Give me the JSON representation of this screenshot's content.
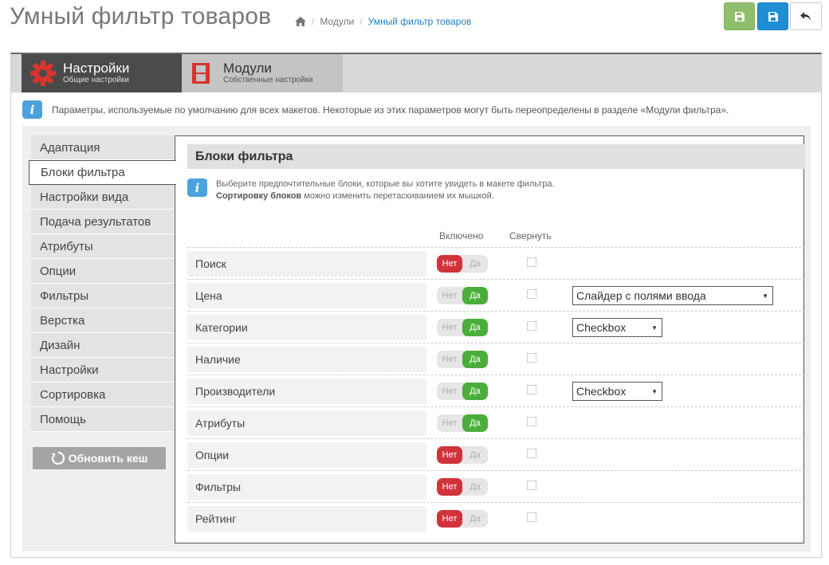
{
  "header": {
    "title": "Умный фильтр товаров",
    "breadcrumb": [
      "Модули",
      "Умный фильтр товаров"
    ]
  },
  "tabs": [
    {
      "title": "Настройки",
      "subtitle": "Общие настройки",
      "active": true
    },
    {
      "title": "Модули",
      "subtitle": "Собственные настройки",
      "active": false
    }
  ],
  "notice": "Параметры, используемые по умолчанию для всех макетов. Некоторые из этих параметров могут быть переопределены в разделе «Модули фильтра».",
  "sidebar": {
    "items": [
      {
        "label": "Адаптация"
      },
      {
        "label": "Блоки фильтра"
      },
      {
        "label": "Настройки вида"
      },
      {
        "label": "Подача результатов"
      },
      {
        "label": "Атрибуты"
      },
      {
        "label": "Опции"
      },
      {
        "label": "Фильтры"
      },
      {
        "label": "Верстка"
      },
      {
        "label": "Дизайн"
      },
      {
        "label": "Настройки"
      },
      {
        "label": "Сортировка"
      },
      {
        "label": "Помощь"
      }
    ],
    "active_index": 1,
    "refresh_label": "Обновить кеш"
  },
  "content": {
    "title": "Блоки фильтра",
    "info_line1": "Выберите предпочтительные блоки, которые вы хотите увидеть в макете фильтра.",
    "info_bold": "Сортировку блоков",
    "info_rest": " можно изменить перетаскиванием их мышкой.",
    "col_enabled": "Включено",
    "col_collapse": "Свернуть",
    "toggle_no": "Нет",
    "toggle_yes": "Да",
    "rows": [
      {
        "label": "Поиск",
        "enabled": false,
        "collapsed": false,
        "select": null
      },
      {
        "label": "Цена",
        "enabled": true,
        "collapsed": false,
        "select": "Слайдер с полями ввода"
      },
      {
        "label": "Категории",
        "enabled": true,
        "collapsed": false,
        "select": "Checkbox"
      },
      {
        "label": "Наличие",
        "enabled": true,
        "collapsed": false,
        "select": null
      },
      {
        "label": "Производители",
        "enabled": true,
        "collapsed": false,
        "select": "Checkbox"
      },
      {
        "label": "Атрибуты",
        "enabled": true,
        "collapsed": false,
        "select": null
      },
      {
        "label": "Опции",
        "enabled": false,
        "collapsed": false,
        "select": null
      },
      {
        "label": "Фильтры",
        "enabled": false,
        "collapsed": false,
        "select": null
      },
      {
        "label": "Рейтинг",
        "enabled": false,
        "collapsed": false,
        "select": null
      }
    ]
  },
  "colors": {
    "toggle_no": "#d0333b",
    "toggle_yes": "#4bae3b",
    "save_button": "#8fbf6c",
    "save_stay_button": "#1e8fd5",
    "info_icon": "#4ba3de"
  }
}
